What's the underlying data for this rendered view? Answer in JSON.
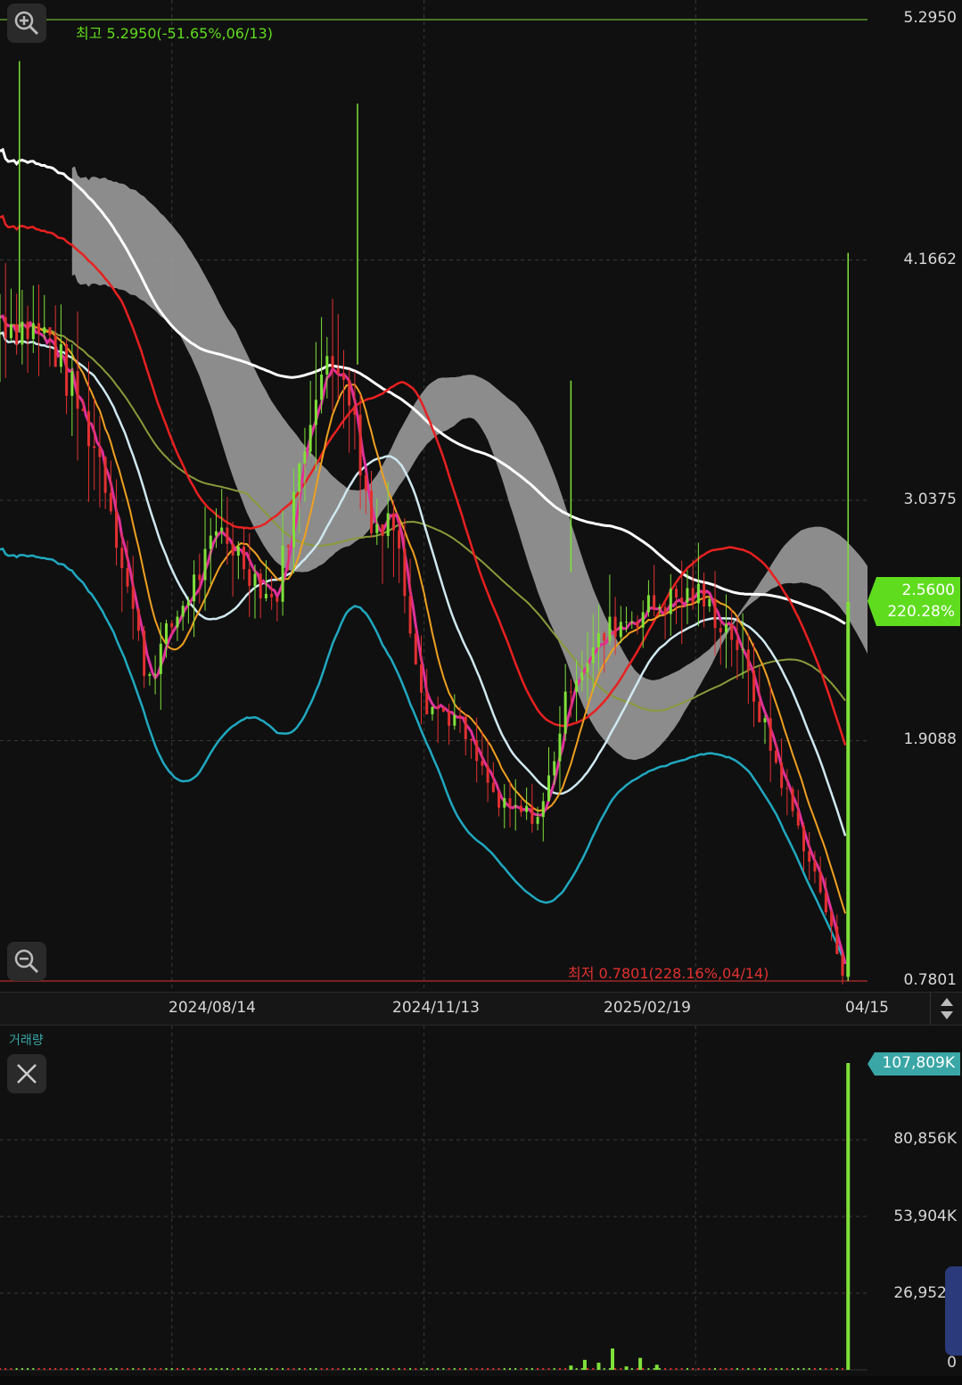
{
  "price_panel": {
    "high_annotation": "최고 5.2950(-51.65%,06/13)",
    "low_annotation": "최저 0.7801(228.16%,04/14)",
    "current_price_tag": "2.5600",
    "current_change_tag": "220.28%",
    "y_ticks": [
      "5.2950",
      "4.1662",
      "3.0375",
      "1.9088",
      "0.7801"
    ],
    "x_ticks": [
      "2024/08/14",
      "2024/11/13",
      "2025/02/19",
      "04/15"
    ]
  },
  "volume_panel": {
    "title": "거래량",
    "current_volume_tag": "107,809K",
    "y_ticks": [
      "80,856K",
      "53,904K",
      "26,952K",
      "0"
    ]
  },
  "colors": {
    "background": "#101010",
    "grid": "#3a3a3a",
    "up": "#7fe03a",
    "down": "#e23030",
    "ma_white": "#ffffff",
    "ma_red": "#e82020",
    "ma_olive": "#8a9a3a",
    "ma_lightblue": "#cfe8f0",
    "ma_orange": "#f0a020",
    "ma_magenta": "#e0309a",
    "ma_cyan": "#20a8c0",
    "ma_green": "#40d040",
    "cloud": "#9a9a9a",
    "price_tag_bg": "#5fdc1e",
    "volume_tag_bg": "#3aa6a6"
  },
  "chart_data": [
    {
      "type": "candlestick",
      "title": "",
      "x_range": [
        "2024-06-13",
        "2025-04-15"
      ],
      "ylim": [
        0.7801,
        5.295
      ],
      "high": {
        "value": 5.295,
        "date": "06/13",
        "change": "-51.65%"
      },
      "low": {
        "value": 0.7801,
        "date": "04/14",
        "change": "228.16%"
      },
      "last_close": 2.56,
      "approx_close_path": [
        {
          "x": "2024-06-13",
          "y": 3.9
        },
        {
          "x": "2024-07-01",
          "y": 3.8
        },
        {
          "x": "2024-07-20",
          "y": 3.2
        },
        {
          "x": "2024-08-05",
          "y": 2.2
        },
        {
          "x": "2024-08-14",
          "y": 2.45
        },
        {
          "x": "2024-09-01",
          "y": 2.9
        },
        {
          "x": "2024-09-20",
          "y": 2.55
        },
        {
          "x": "2024-10-05",
          "y": 3.6
        },
        {
          "x": "2024-10-15",
          "y": 3.7
        },
        {
          "x": "2024-10-25",
          "y": 2.9
        },
        {
          "x": "2024-11-01",
          "y": 3.0
        },
        {
          "x": "2024-11-13",
          "y": 2.1
        },
        {
          "x": "2024-11-25",
          "y": 2.0
        },
        {
          "x": "2024-12-10",
          "y": 1.6
        },
        {
          "x": "2024-12-25",
          "y": 1.55
        },
        {
          "x": "2025-01-05",
          "y": 2.2
        },
        {
          "x": "2025-01-20",
          "y": 2.45
        },
        {
          "x": "2025-02-05",
          "y": 2.55
        },
        {
          "x": "2025-02-19",
          "y": 2.6
        },
        {
          "x": "2025-03-05",
          "y": 2.4
        },
        {
          "x": "2025-03-20",
          "y": 1.8
        },
        {
          "x": "2025-04-05",
          "y": 1.2
        },
        {
          "x": "2025-04-14",
          "y": 0.78
        },
        {
          "x": "2025-04-15",
          "y": 2.56
        }
      ]
    },
    {
      "type": "bar",
      "title": "거래량",
      "ylim": [
        0,
        107809
      ],
      "unit": "K",
      "last_value": 107809,
      "approx_bars": [
        {
          "x": "2025-01-05",
          "y": 1500
        },
        {
          "x": "2025-01-10",
          "y": 3500
        },
        {
          "x": "2025-01-15",
          "y": 2500
        },
        {
          "x": "2025-01-20",
          "y": 7500
        },
        {
          "x": "2025-01-25",
          "y": 1200
        },
        {
          "x": "2025-01-30",
          "y": 4200
        },
        {
          "x": "2025-02-05",
          "y": 1800
        },
        {
          "x": "2025-04-15",
          "y": 107809
        }
      ]
    }
  ]
}
